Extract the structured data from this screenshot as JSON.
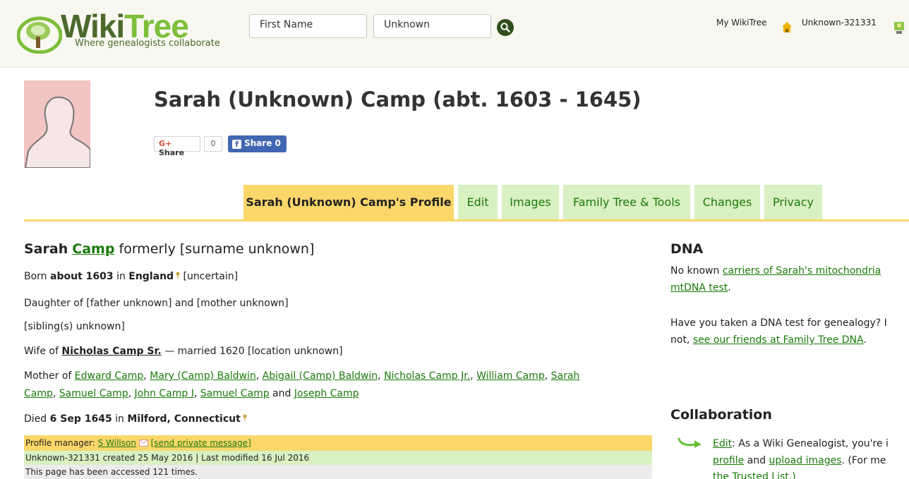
{
  "header": {
    "logo_text_1": "Wiki",
    "logo_text_2": "Tree",
    "tagline": "Where genealogists collaborate",
    "search_first_value": "First Name",
    "search_last_value": "Unknown",
    "my_wikitree": "My WikiTree",
    "user_id": "Unknown-321331"
  },
  "profile": {
    "title": "Sarah (Unknown) Camp (abt. 1603 - 1645)",
    "gplus_share": "Share",
    "gplus_count": "0",
    "fb_share": "Share 0"
  },
  "tabs": [
    {
      "label": "Sarah (Unknown) Camp's Profile"
    },
    {
      "label": "Edit"
    },
    {
      "label": "Images"
    },
    {
      "label": "Family Tree & Tools"
    },
    {
      "label": "Changes"
    },
    {
      "label": "Privacy"
    }
  ],
  "bio": {
    "first_name": "Sarah",
    "surname": "Camp",
    "formerly": "formerly [surname unknown]",
    "born_prefix": "Born",
    "born_date": "about 1603",
    "born_in": "in",
    "born_place": "England",
    "born_uncertain": "[uncertain]",
    "daughter_of": "Daughter of [father unknown] and [mother unknown]",
    "siblings": "[sibling(s) unknown]",
    "wife_prefix": "Wife of",
    "husband": "Nicholas Camp Sr.",
    "married": "— married 1620 [location unknown]",
    "mother_prefix": "Mother of",
    "children": [
      "Edward Camp",
      "Mary (Camp) Baldwin",
      "Abigail (Camp) Baldwin",
      "Nicholas Camp Jr.",
      "William Camp",
      "Sarah",
      "Camp",
      "Samuel Camp",
      "John Camp I",
      "Samuel Camp",
      "Joseph Camp"
    ],
    "and": "and",
    "died_prefix": "Died",
    "died_date": "6 Sep 1645",
    "died_in": "in",
    "died_place": "Milford, Connecticut"
  },
  "meta": {
    "manager_label": "Profile manager:",
    "manager_name": "S Willson",
    "send_message": "[send private message]",
    "created": "Unknown-321331 created 25 May 2016 | Last modified 16 Jul 2016",
    "accessed": "This page has been accessed 121 times."
  },
  "dna": {
    "heading": "DNA",
    "line1_prefix": "No known",
    "line1_link": "carriers of Sarah's mitochondria",
    "line2_link": "mtDNA test",
    "line2_suffix": ".",
    "q1": "Have you taken a DNA test for genealogy? I",
    "q2_prefix": "not,",
    "q2_link": "see our friends at Family Tree DNA",
    "q2_suffix": "."
  },
  "collab": {
    "heading": "Collaboration",
    "edit_link": "Edit",
    "edit_text": ": As a Wiki Genealogist, you're i",
    "profile_link": "profile",
    "and_text": "and",
    "upload_link": "upload images",
    "for_text": ". (For me",
    "trusted_link": "the Trusted List.)"
  },
  "colors": {
    "tab_active": "#fbd76a",
    "tab_inactive": "#d9f0c2",
    "link": "#1a7a0a",
    "header_bg": "#f8f8f1",
    "fb_blue": "#4267b2"
  },
  "icons": [
    "wikitree-logo-icon",
    "search-icon",
    "home-icon",
    "user-icon",
    "location-pin-icon",
    "envelope-icon",
    "google-plus-icon",
    "facebook-icon",
    "curved-arrow-icon"
  ]
}
